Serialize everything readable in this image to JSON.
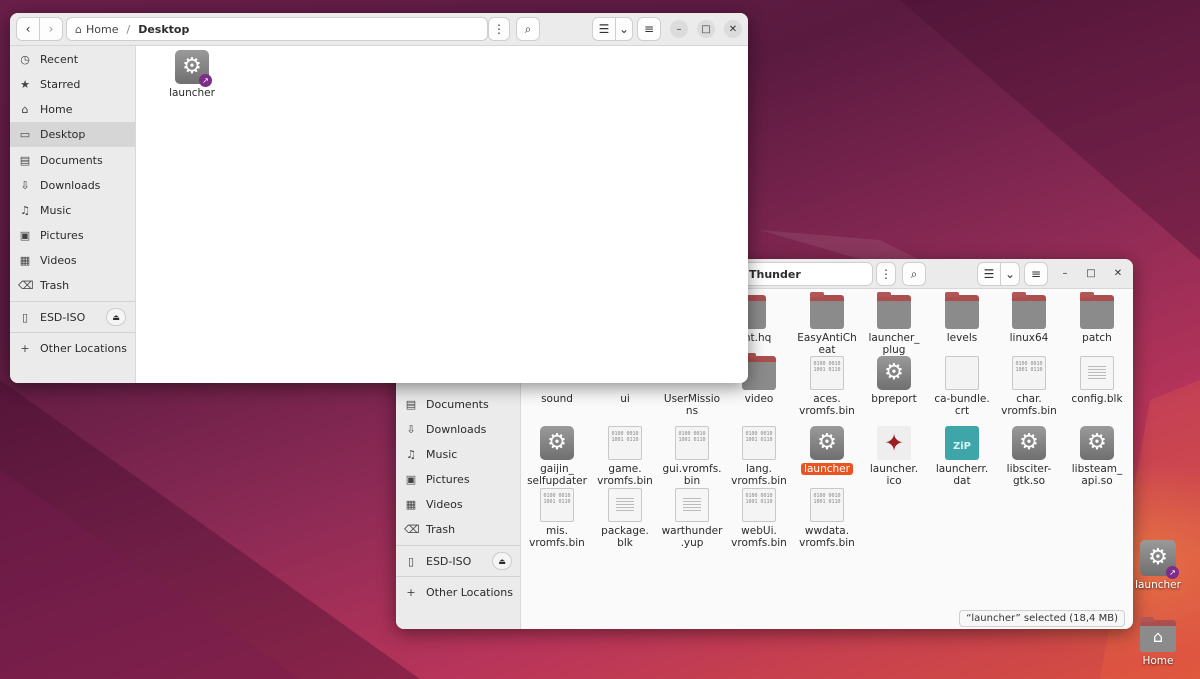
{
  "colors": {
    "accent": "#e95420",
    "selection_bg": "#d6d6d6",
    "folder": "#8b8b8b",
    "folder_top": "#ad4e4e"
  },
  "window_front": {
    "breadcrumb": [
      {
        "label": "Home",
        "icon": "home-icon"
      },
      {
        "label": "Desktop"
      }
    ],
    "sidebar": [
      {
        "label": "Recent",
        "icon": "clock-icon"
      },
      {
        "label": "Starred",
        "icon": "star-icon"
      },
      {
        "label": "Home",
        "icon": "home-icon"
      },
      {
        "label": "Desktop",
        "icon": "desktop-icon",
        "selected": true
      },
      {
        "label": "Documents",
        "icon": "document-icon"
      },
      {
        "label": "Downloads",
        "icon": "download-icon"
      },
      {
        "label": "Music",
        "icon": "music-icon"
      },
      {
        "label": "Pictures",
        "icon": "picture-icon"
      },
      {
        "label": "Videos",
        "icon": "video-icon"
      },
      {
        "label": "Trash",
        "icon": "trash-icon"
      }
    ],
    "device": {
      "label": "ESD-ISO",
      "icon": "drive-icon"
    },
    "other_locations": "Other Locations",
    "files": [
      {
        "name": "launcher",
        "type": "executable-link"
      }
    ]
  },
  "window_back": {
    "breadcrumb_current": "Thunder",
    "sidebar": [
      {
        "label": "Documents",
        "icon": "document-icon"
      },
      {
        "label": "Downloads",
        "icon": "download-icon"
      },
      {
        "label": "Music",
        "icon": "music-icon"
      },
      {
        "label": "Pictures",
        "icon": "picture-icon"
      },
      {
        "label": "Videos",
        "icon": "video-icon"
      },
      {
        "label": "Trash",
        "icon": "trash-icon"
      }
    ],
    "device": {
      "label": "ESD-ISO",
      "icon": "drive-icon"
    },
    "other_locations": "Other Locations",
    "files": [
      {
        "name": "ntent.hq",
        "type": "folder"
      },
      {
        "name": "EasyAntiCh\neat",
        "type": "folder"
      },
      {
        "name": "launcher_\nplug",
        "type": "folder"
      },
      {
        "name": "levels",
        "type": "folder"
      },
      {
        "name": "linux64",
        "type": "folder"
      },
      {
        "name": "patch",
        "type": "folder"
      },
      {
        "name": "sound",
        "type": "folder"
      },
      {
        "name": "ui",
        "type": "folder"
      },
      {
        "name": "UserMissio\nns",
        "type": "folder"
      },
      {
        "name": "video",
        "type": "folder"
      },
      {
        "name": "aces.\nvromfs.bin",
        "type": "binary"
      },
      {
        "name": "bpreport",
        "type": "executable"
      },
      {
        "name": "ca-bundle.\ncrt",
        "type": "blank"
      },
      {
        "name": "char.\nvromfs.bin",
        "type": "binary"
      },
      {
        "name": "config.blk",
        "type": "text"
      },
      {
        "name": "gaijin_\nselfupdater",
        "type": "executable"
      },
      {
        "name": "game.\nvromfs.bin",
        "type": "binary"
      },
      {
        "name": "gui.vromfs.\nbin",
        "type": "binary"
      },
      {
        "name": "lang.\nvromfs.bin",
        "type": "binary"
      },
      {
        "name": "launcher",
        "type": "executable",
        "selected": true
      },
      {
        "name": "launcher.\nico",
        "type": "ico"
      },
      {
        "name": "launcherr.\ndat",
        "type": "zip"
      },
      {
        "name": "libsciter-\ngtk.so",
        "type": "executable"
      },
      {
        "name": "libsteam_\napi.so",
        "type": "executable"
      },
      {
        "name": "mis.\nvromfs.bin",
        "type": "binary"
      },
      {
        "name": "package.\nblk",
        "type": "text"
      },
      {
        "name": "warthunder\n.yup",
        "type": "text"
      },
      {
        "name": "webUi.\nvromfs.bin",
        "type": "binary"
      },
      {
        "name": "wwdata.\nvromfs.bin",
        "type": "binary"
      }
    ],
    "status": "“launcher” selected  (18,4 MB)"
  },
  "desktop": [
    {
      "label": "launcher",
      "icon": "gear-icon"
    },
    {
      "label": "Home",
      "icon": "home-folder-icon"
    }
  ],
  "glyphs": {
    "back": "‹",
    "forward": "›",
    "home": "⌂",
    "menu": "⋮",
    "search": "⌕",
    "list": "☰",
    "chevron": "⌄",
    "hamburger": "≡",
    "minimize": "–",
    "maximize": "□",
    "close": "✕",
    "eject": "⏏",
    "plus": "+",
    "gear": "⚙",
    "link": "↗",
    "zip": "ZiP",
    "ico": "✦",
    "bin": "0100 0010 1001 0110"
  }
}
